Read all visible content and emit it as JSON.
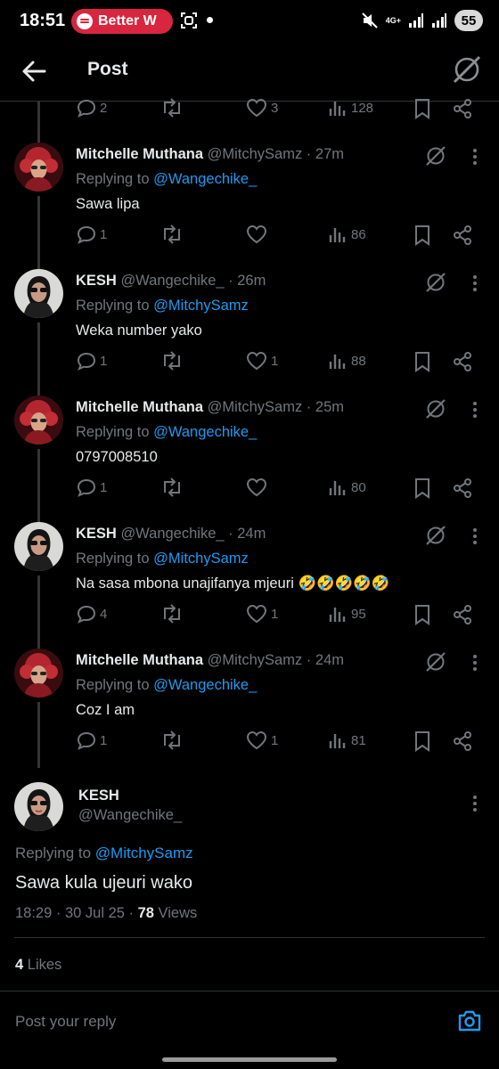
{
  "status_bar": {
    "time": "18:51",
    "media_app": "Better W",
    "network": "4G+",
    "battery": "55"
  },
  "header": {
    "title": "Post"
  },
  "top_action_row": {
    "replies": "2",
    "reposts": "",
    "likes": "3",
    "views": "128"
  },
  "replies": [
    {
      "name": "Mitchelle Muthana",
      "handle": "@MitchySamz",
      "time": "27m",
      "replying_label": "Replying to",
      "replying_to": "@Wangechike_",
      "text": "Sawa lipa",
      "replies": "1",
      "reposts": "",
      "likes": "",
      "views": "86"
    },
    {
      "name": "KESH",
      "handle": "@Wangechike_",
      "time": "26m",
      "replying_label": "Replying to",
      "replying_to": "@MitchySamz",
      "text": "Weka number yako",
      "replies": "1",
      "reposts": "",
      "likes": "1",
      "views": "88"
    },
    {
      "name": "Mitchelle Muthana",
      "handle": "@MitchySamz",
      "time": "25m",
      "replying_label": "Replying to",
      "replying_to": "@Wangechike_",
      "text": "0797008510",
      "replies": "1",
      "reposts": "",
      "likes": "",
      "views": "80"
    },
    {
      "name": "KESH",
      "handle": "@Wangechike_",
      "time": "24m",
      "replying_label": "Replying to",
      "replying_to": "@MitchySamz",
      "text": "Na sasa mbona unajifanya mjeuri 🤣🤣🤣🤣🤣",
      "replies": "4",
      "reposts": "",
      "likes": "1",
      "views": "95"
    },
    {
      "name": "Mitchelle Muthana",
      "handle": "@MitchySamz",
      "time": "24m",
      "replying_label": "Replying to",
      "replying_to": "@Wangechike_",
      "text": "Coz I am",
      "replies": "1",
      "reposts": "",
      "likes": "1",
      "views": "81"
    }
  ],
  "main_post": {
    "name": "KESH",
    "handle": "@Wangechike_",
    "replying_label": "Replying to",
    "replying_to": "@MitchySamz",
    "text": "Sawa kula ujeuri wako",
    "timestamp": "18:29 · 30 Jul 25 · ",
    "views_count": "78",
    "views_label": " Views",
    "likes_count": "4",
    "likes_label": " Likes"
  },
  "reply_box": {
    "placeholder": "Post your reply"
  },
  "colors": {
    "accent": "#1d9bf0",
    "muted": "#71767b",
    "text": "#e7e9ea",
    "background": "#000000",
    "spotify_pill": "#d7263d"
  }
}
